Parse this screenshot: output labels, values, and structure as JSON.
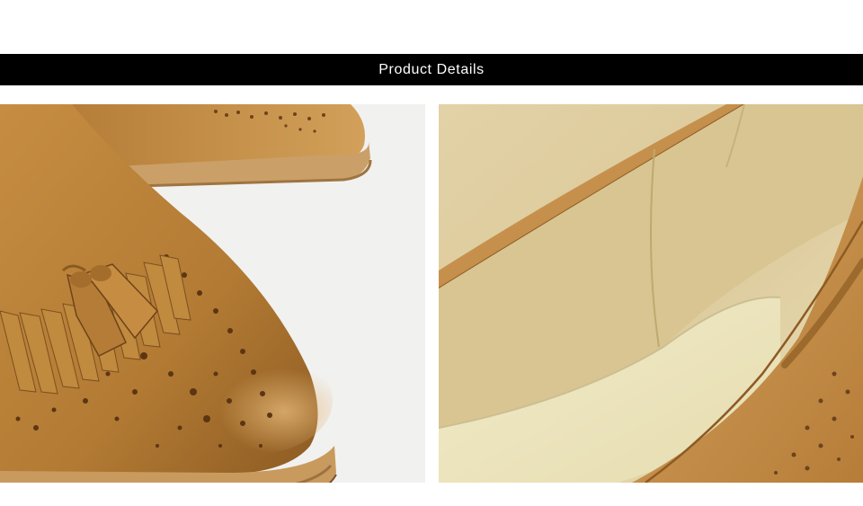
{
  "header": {
    "title": "Product Details"
  },
  "photos": [
    {
      "subject": "tassel-loafer-toe-closeup"
    },
    {
      "subject": "loafer-insole-closeup"
    }
  ],
  "colors": {
    "banner": "#000000",
    "banner_text": "#ffffff",
    "leather": "#b8803a",
    "leather_dark": "#8a5a22",
    "sole": "#c99a5e",
    "insole": "#e6d9b0"
  }
}
